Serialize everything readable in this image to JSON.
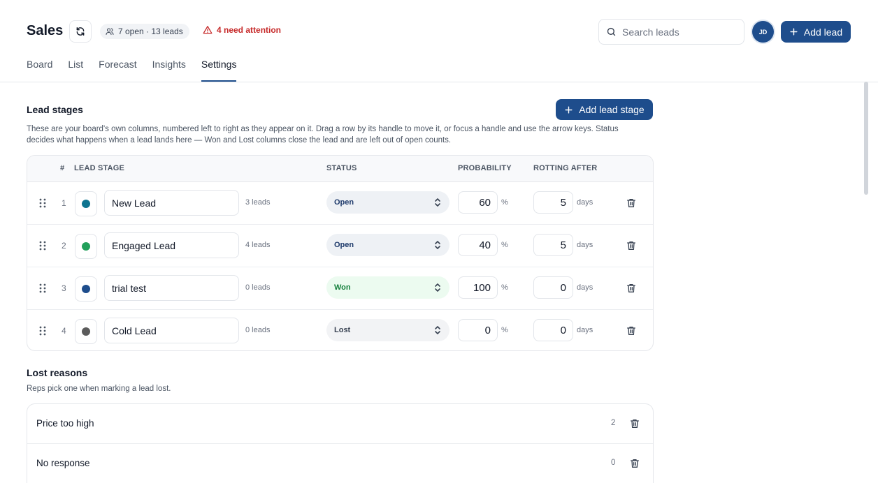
{
  "header": {
    "title": "Sales",
    "count_summary": "7 open · 13 leads",
    "attention_text": "4 need attention",
    "search_placeholder": "Search leads",
    "avatar_initials": "JD",
    "add_lead_label": "Add lead"
  },
  "tabs": [
    {
      "label": "Board",
      "active": false
    },
    {
      "label": "List",
      "active": false
    },
    {
      "label": "Forecast",
      "active": false
    },
    {
      "label": "Insights",
      "active": false
    },
    {
      "label": "Settings",
      "active": true
    }
  ],
  "lead_stages": {
    "title": "Lead stages",
    "add_label": "Add lead stage",
    "description_line1": "These are your board's own columns, numbered left to right as they appear on it. Drag a row by its handle to move it, or focus a handle and use the arrow keys. Status",
    "description_line2": "decides what happens when a lead lands here — Won and Lost columns close the lead and are left out of open counts.",
    "columns": {
      "number": "#",
      "stage": "LEAD STAGE",
      "status": "STATUS",
      "probability": "PROBABILITY",
      "rotting": "ROTTING AFTER"
    },
    "rows": [
      {
        "number": "1",
        "name": "New Lead",
        "color": "#0e7490",
        "lead_count": "3 leads",
        "status": "Open",
        "status_kind": "open",
        "probability": "60",
        "prob_unit": "%",
        "rotting": "5",
        "rot_unit": "days"
      },
      {
        "number": "2",
        "name": "Engaged Lead",
        "color": "#22a05b",
        "lead_count": "4 leads",
        "status": "Open",
        "status_kind": "open",
        "probability": "40",
        "prob_unit": "%",
        "rotting": "5",
        "rot_unit": "days"
      },
      {
        "number": "3",
        "name": "trial test",
        "color": "#1e4d8c",
        "lead_count": "0 leads",
        "status": "Won",
        "status_kind": "won",
        "probability": "100",
        "prob_unit": "%",
        "rotting": "0",
        "rot_unit": "days"
      },
      {
        "number": "4",
        "name": "Cold Lead",
        "color": "#5b5b5b",
        "lead_count": "0 leads",
        "status": "Lost",
        "status_kind": "lost",
        "probability": "0",
        "prob_unit": "%",
        "rotting": "0",
        "rot_unit": "days"
      }
    ]
  },
  "lost_reasons": {
    "title": "Lost reasons",
    "description": "Reps pick one when marking a lead lost.",
    "rows": [
      {
        "label": "Price too high",
        "count": "2"
      },
      {
        "label": "No response",
        "count": "0"
      }
    ]
  },
  "colors": {
    "accent": "#1e4d8c",
    "danger": "#c62828",
    "won": "#15803d"
  }
}
